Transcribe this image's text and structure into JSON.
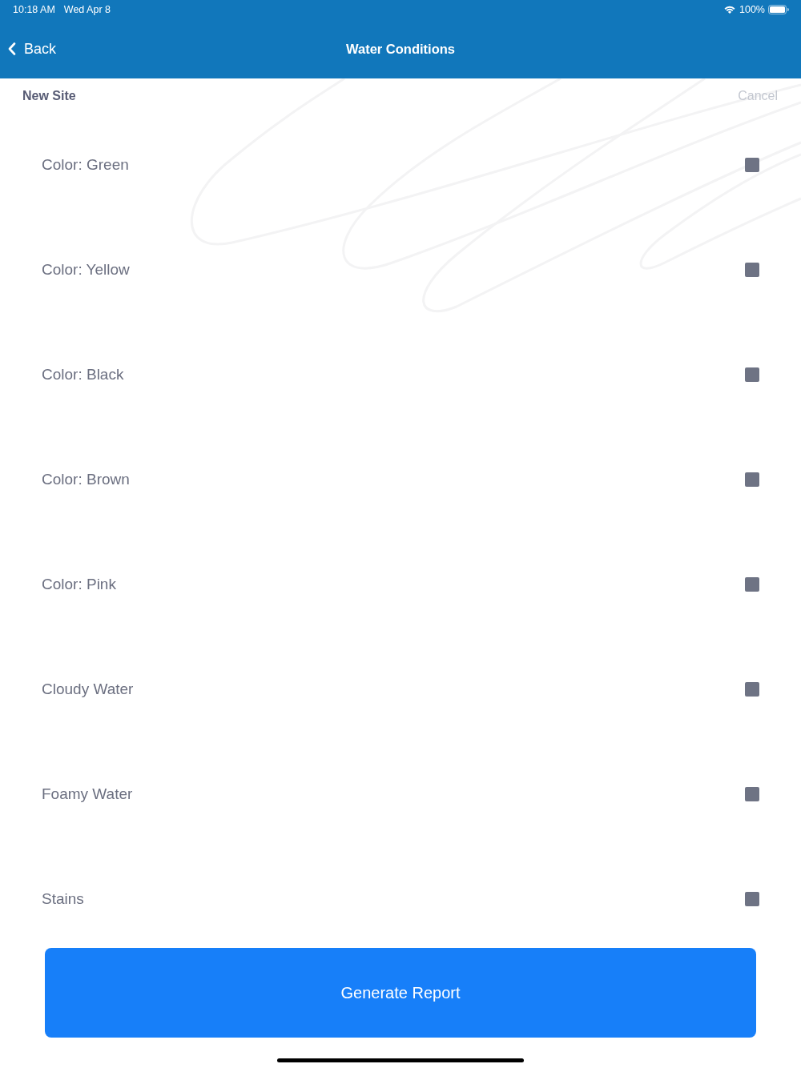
{
  "status_bar": {
    "time": "10:18 AM",
    "date": "Wed Apr 8",
    "battery": "100%"
  },
  "nav_bar": {
    "back": "Back",
    "title": "Water Conditions"
  },
  "sub_header": {
    "title": "New Site",
    "cancel": {
      "label": "Cancel",
      "disabled": true
    }
  },
  "conditions": [
    {
      "label": "Color: Green",
      "checked": false
    },
    {
      "label": "Color: Yellow",
      "checked": false
    },
    {
      "label": "Color: Black",
      "checked": false
    },
    {
      "label": "Color: Brown",
      "checked": false
    },
    {
      "label": "Color: Pink",
      "checked": false
    },
    {
      "label": "Cloudy Water",
      "checked": false
    },
    {
      "label": "Foamy Water",
      "checked": false
    },
    {
      "label": "Stains",
      "checked": false
    }
  ],
  "generate_button": {
    "label": "Generate Report"
  }
}
